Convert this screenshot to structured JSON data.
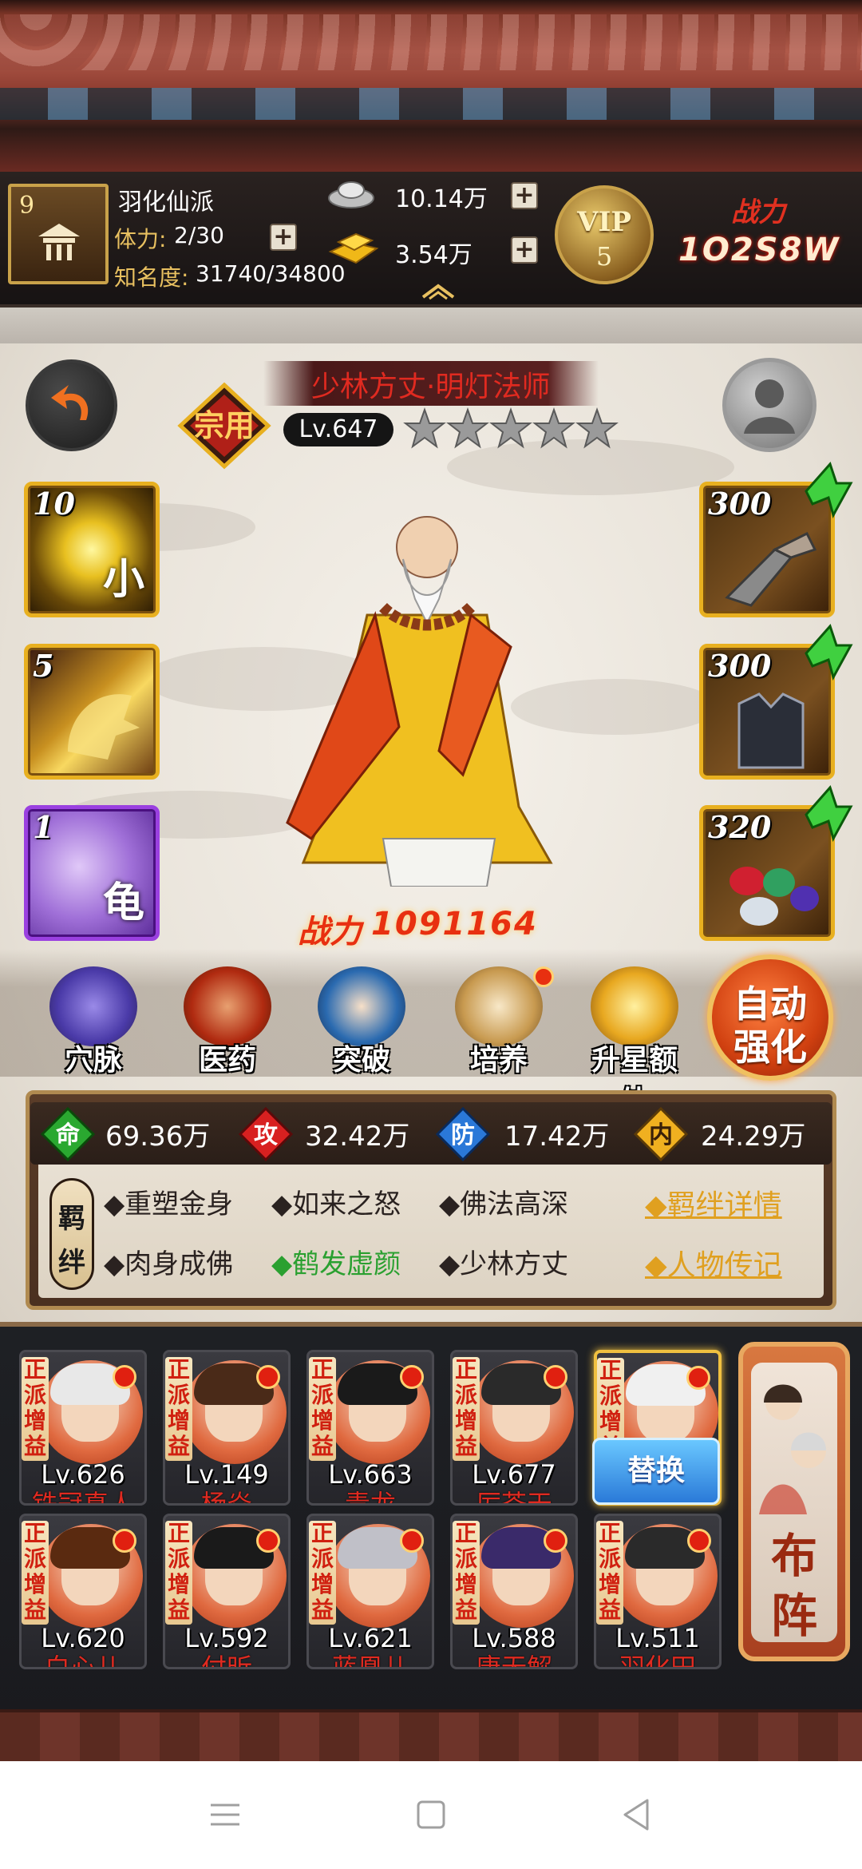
{
  "header": {
    "sect_level": "9",
    "sect_name": "羽化仙派",
    "stamina_label": "体力:",
    "stamina_value": "2/30",
    "fame_label": "知名度:",
    "fame_value": "31740/34800",
    "silver": "10.14万",
    "gold": "3.54万",
    "vip_label": "VIP",
    "vip_level": "5",
    "power_label": "战力",
    "power_value": "1O2S8W"
  },
  "hero": {
    "rank": "宗用",
    "title": "少林方丈·明灯法师",
    "level": "Lv.647",
    "stars": 5,
    "power_label": "战力",
    "power_value": "1091164",
    "skills": [
      {
        "level": "10",
        "glyph": "小"
      },
      {
        "level": "5",
        "glyph": ""
      },
      {
        "level": "1",
        "glyph": "龟"
      }
    ],
    "equipment": [
      {
        "level": "300",
        "upgradable": true
      },
      {
        "level": "300",
        "upgradable": true
      },
      {
        "level": "320",
        "upgradable": true
      }
    ]
  },
  "actions": [
    {
      "label": "穴脉",
      "dot": false
    },
    {
      "label": "医药",
      "dot": false
    },
    {
      "label": "突破",
      "dot": false
    },
    {
      "label": "培养",
      "dot": true
    },
    {
      "label": "升星额外",
      "dot": false
    }
  ],
  "auto_strengthen": {
    "line1": "自动",
    "line2": "强化"
  },
  "stats": [
    {
      "icon": "命",
      "value": "69.36万"
    },
    {
      "icon": "攻",
      "value": "32.42万"
    },
    {
      "icon": "防",
      "value": "17.42万"
    },
    {
      "icon": "内",
      "value": "24.29万"
    }
  ],
  "bonds": {
    "label_top": "羁",
    "label_bottom": "绊",
    "items": [
      {
        "text": "◆重塑金身",
        "active": false
      },
      {
        "text": "◆如来之怒",
        "active": false
      },
      {
        "text": "◆佛法高深",
        "active": false
      },
      {
        "text": "◆肉身成佛",
        "active": false
      },
      {
        "text": "◆鹤发虚颜",
        "active": true
      },
      {
        "text": "◆少林方丈",
        "active": false
      }
    ],
    "details_link": "◆羁绊详情",
    "bio_link": "◆人物传记"
  },
  "team": {
    "tag": [
      "正",
      "派",
      "增",
      "益"
    ],
    "replace_label": "替换",
    "formation": {
      "line1": "布",
      "line2": "阵"
    },
    "row1": [
      {
        "level": "Lv.626",
        "name": "铁冠真人"
      },
      {
        "level": "Lv.149",
        "name": "杨焱"
      },
      {
        "level": "Lv.663",
        "name": "青龙"
      },
      {
        "level": "Lv.677",
        "name": "厉苍天"
      },
      {
        "level": "",
        "name": ""
      }
    ],
    "row2": [
      {
        "level": "Lv.620",
        "name": "白心儿"
      },
      {
        "level": "Lv.592",
        "name": "付昕"
      },
      {
        "level": "Lv.621",
        "name": "蓝凰儿"
      },
      {
        "level": "Lv.588",
        "name": "唐无解"
      },
      {
        "level": "Lv.511",
        "name": "羽化田"
      }
    ]
  },
  "colors": {
    "accent_gold": "#e8b020",
    "hero_title_red": "#e02a20",
    "bond_active_green": "#2aa030",
    "link_orange": "#e0a020"
  }
}
